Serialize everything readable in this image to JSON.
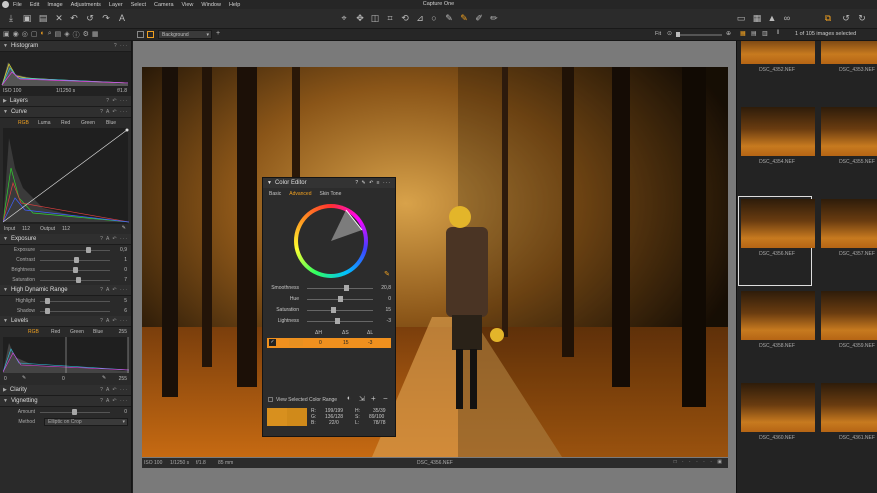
{
  "app": {
    "title": "Capture One",
    "menu": [
      "File",
      "Edit",
      "Image",
      "Adjustments",
      "Layer",
      "Select",
      "Camera",
      "View",
      "Window",
      "Help"
    ]
  },
  "toolbar2": {
    "layer": "Background",
    "fit": "Fit",
    "count": "1 of 105 images selected"
  },
  "histogram": {
    "title": "Histogram",
    "iso": "ISO 100",
    "shutter": "1/1250 s",
    "aperture": "f/1.8"
  },
  "layers": {
    "title": "Layers"
  },
  "curve": {
    "title": "Curve",
    "tabs": [
      "RGB",
      "Luma",
      "Red",
      "Green",
      "Blue"
    ],
    "input_label": "Input",
    "input": "112",
    "output_label": "Output",
    "output": "112"
  },
  "exposure": {
    "title": "Exposure",
    "rows": [
      {
        "label": "Exposure",
        "value": "0,9",
        "pos": 0.7
      },
      {
        "label": "Contrast",
        "value": "1",
        "pos": 0.52
      },
      {
        "label": "Brightness",
        "value": "0",
        "pos": 0.5
      },
      {
        "label": "Saturation",
        "value": "7",
        "pos": 0.55
      }
    ]
  },
  "hdr": {
    "title": "High Dynamic Range",
    "rows": [
      {
        "label": "Highlight",
        "value": "5",
        "pos": 0.08
      },
      {
        "label": "Shadow",
        "value": "6",
        "pos": 0.08
      }
    ]
  },
  "levels": {
    "title": "Levels",
    "tabs": [
      "RGB",
      "Red",
      "Green",
      "Blue"
    ],
    "max": "255",
    "low": "0",
    "mid": "0",
    "high": "255"
  },
  "clarity": {
    "title": "Clarity"
  },
  "vignetting": {
    "title": "Vignetting",
    "amount_label": "Amount",
    "amount": "0",
    "method_label": "Method",
    "method": "Elliptic on Crop"
  },
  "status": {
    "iso": "ISO 100",
    "shutter": "1/1250 s",
    "aperture": "f/1.8",
    "focal": "85 mm",
    "file": "DSC_4356.NEF"
  },
  "thumbs": [
    "DSC_4352.NEF",
    "DSC_4353.NEF",
    "DSC_4354.NEF",
    "DSC_4355.NEF",
    "DSC_4356.NEF",
    "DSC_4357.NEF",
    "DSC_4358.NEF",
    "DSC_4359.NEF",
    "DSC_4360.NEF",
    "DSC_4361.NEF"
  ],
  "color_editor": {
    "title": "Color Editor",
    "tabs": [
      "Basic",
      "Advanced",
      "Skin Tone"
    ],
    "rows": [
      {
        "label": "Smoothness",
        "value": "20,8",
        "pos": 0.6
      },
      {
        "label": "Hue",
        "value": "0",
        "pos": 0.5
      },
      {
        "label": "Saturation",
        "value": "15",
        "pos": 0.38
      },
      {
        "label": "Lightness",
        "value": "-3",
        "pos": 0.45
      }
    ],
    "cols": [
      "ΔH",
      "ΔS",
      "ΔL"
    ],
    "sel": [
      "0",
      "15",
      "-3"
    ],
    "view_range": "View Selected Color Range",
    "readout": {
      "r": "R:",
      "r_val": "199/199",
      "g": "G:",
      "g_val": "136/128",
      "b": "B:",
      "b_val": "22/0",
      "h": "H:",
      "h_val": "35/39",
      "s": "S:",
      "s_val": "89/100",
      "l": "L:",
      "l_val": "78/78"
    }
  }
}
